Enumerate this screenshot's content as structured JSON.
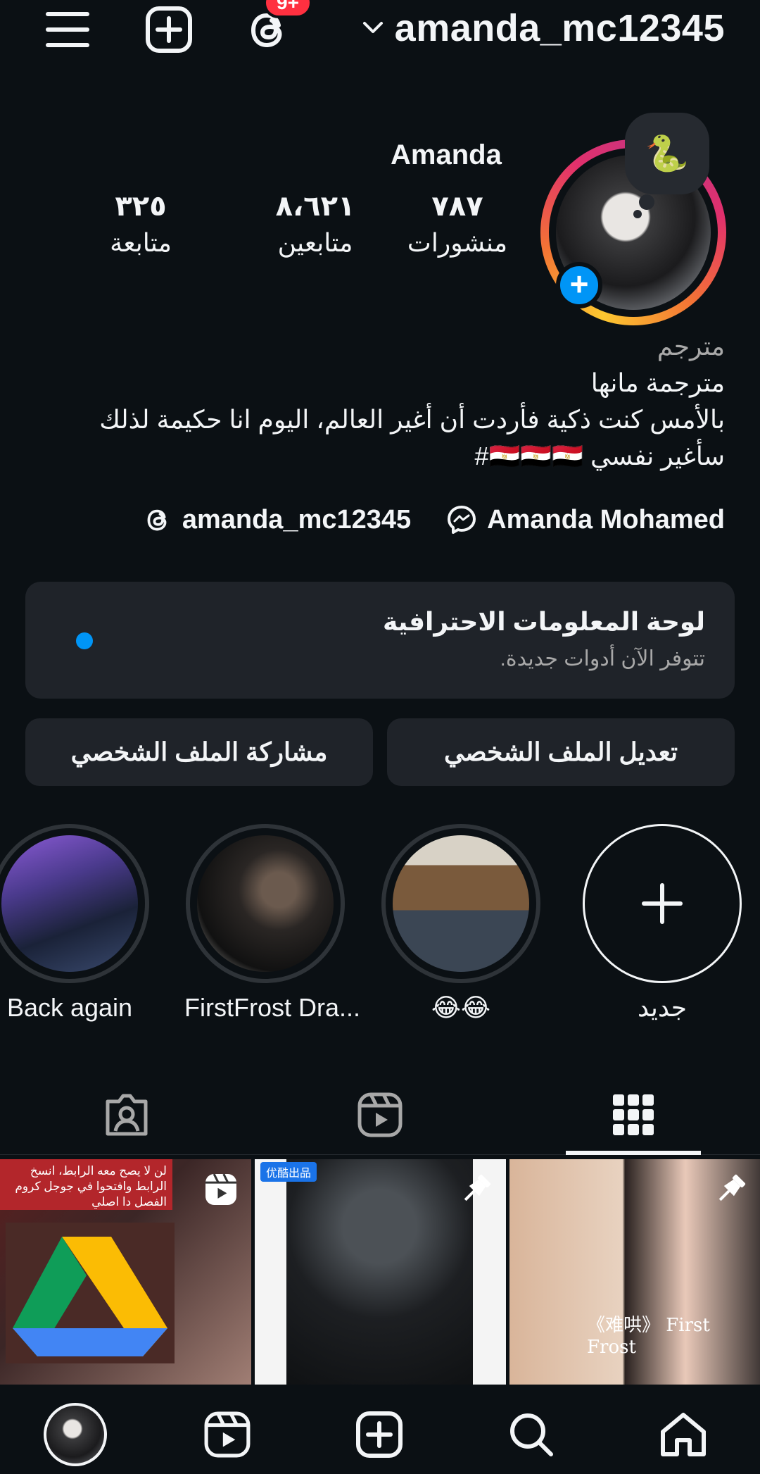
{
  "topbar": {
    "username": "amanda_mc12345",
    "threads_badge": "9+"
  },
  "profile": {
    "display_name": "Amanda",
    "note_emoji": "🐍",
    "stats": {
      "posts": {
        "value": "٧٨٧",
        "label": "منشورات"
      },
      "followers": {
        "value": "٨،٦٢١",
        "label": "متابعين"
      },
      "following": {
        "value": "٣٢٥",
        "label": "متابعة"
      }
    },
    "bio": {
      "category": "مترجم",
      "line1": "مترجمة مانها",
      "line2": "بالأمس كنت ذكية فأردت أن أغير العالم، اليوم انا حكيمة لذلك",
      "line3": "سأغير نفسي 🇪🇬🇪🇬🇪🇬#"
    },
    "threads_handle": "amanda_mc12345",
    "facebook_name": "Amanda Mohamed"
  },
  "dashboard": {
    "title": "لوحة المعلومات الاحترافية",
    "subtitle": "تتوفر الآن أدوات جديدة."
  },
  "actions": {
    "edit_profile": "تعديل الملف الشخصي",
    "share_profile": "مشاركة الملف الشخصي"
  },
  "highlights": [
    {
      "label": "جديد"
    },
    {
      "label": "😂😂"
    },
    {
      "label": "FirstFrost Dra..."
    },
    {
      "label": "Back again"
    }
  ],
  "grid": {
    "tile1_text": "لن لا يصح معه الرابط، انسخ الرابط وافتحوا في جوجل كروم الفصل دا اصلي",
    "tile2_badge": "优酷出品",
    "tile3_caption": "《难哄》 First Frost"
  },
  "colors": {
    "background": "#0b1014",
    "accent": "#0095f6",
    "badge": "#ff3040",
    "surface": "#1f2329"
  }
}
